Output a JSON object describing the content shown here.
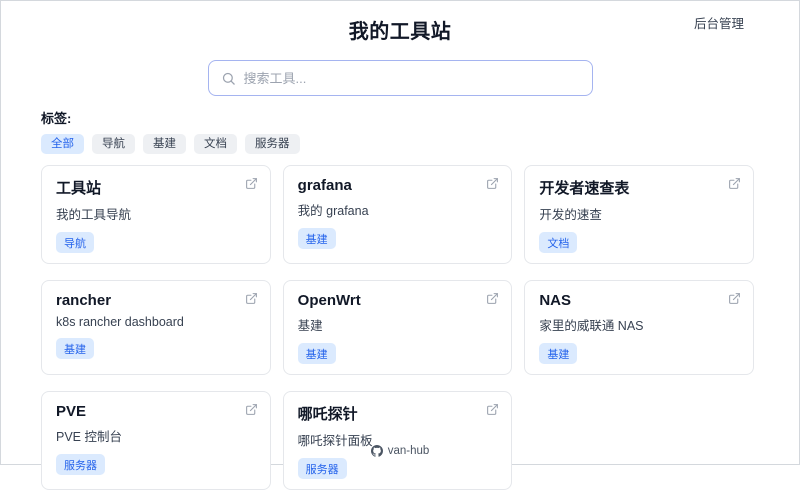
{
  "header": {
    "title": "我的工具站",
    "admin_link": "后台管理"
  },
  "search": {
    "placeholder": "搜索工具..."
  },
  "tags": {
    "label": "标签:",
    "items": [
      {
        "label": "全部",
        "active": true
      },
      {
        "label": "导航",
        "active": false
      },
      {
        "label": "基建",
        "active": false
      },
      {
        "label": "文档",
        "active": false
      },
      {
        "label": "服务器",
        "active": false
      }
    ]
  },
  "cards": [
    {
      "title": "工具站",
      "description": "我的工具导航",
      "tag": "导航"
    },
    {
      "title": "grafana",
      "description": "我的 grafana",
      "tag": "基建"
    },
    {
      "title": "开发者速查表",
      "description": "开发的速查",
      "tag": "文档"
    },
    {
      "title": "rancher",
      "description": "k8s rancher dashboard",
      "tag": "基建"
    },
    {
      "title": "OpenWrt",
      "description": "基建",
      "tag": "基建"
    },
    {
      "title": "NAS",
      "description": "家里的威联通 NAS",
      "tag": "基建"
    },
    {
      "title": "PVE",
      "description": "PVE 控制台",
      "tag": "服务器"
    },
    {
      "title": "哪吒探针",
      "description": "哪吒探针面板",
      "tag": "服务器"
    }
  ],
  "footer": {
    "brand": "van-hub"
  },
  "icons": {
    "search": "search-icon",
    "card_link": "external-link-icon",
    "footer": "github-icon"
  },
  "colors": {
    "accent": "#2563eb",
    "tag_bg": "#dbeafe",
    "search_border": "#a5b4f0",
    "card_border": "#e5e7eb"
  }
}
